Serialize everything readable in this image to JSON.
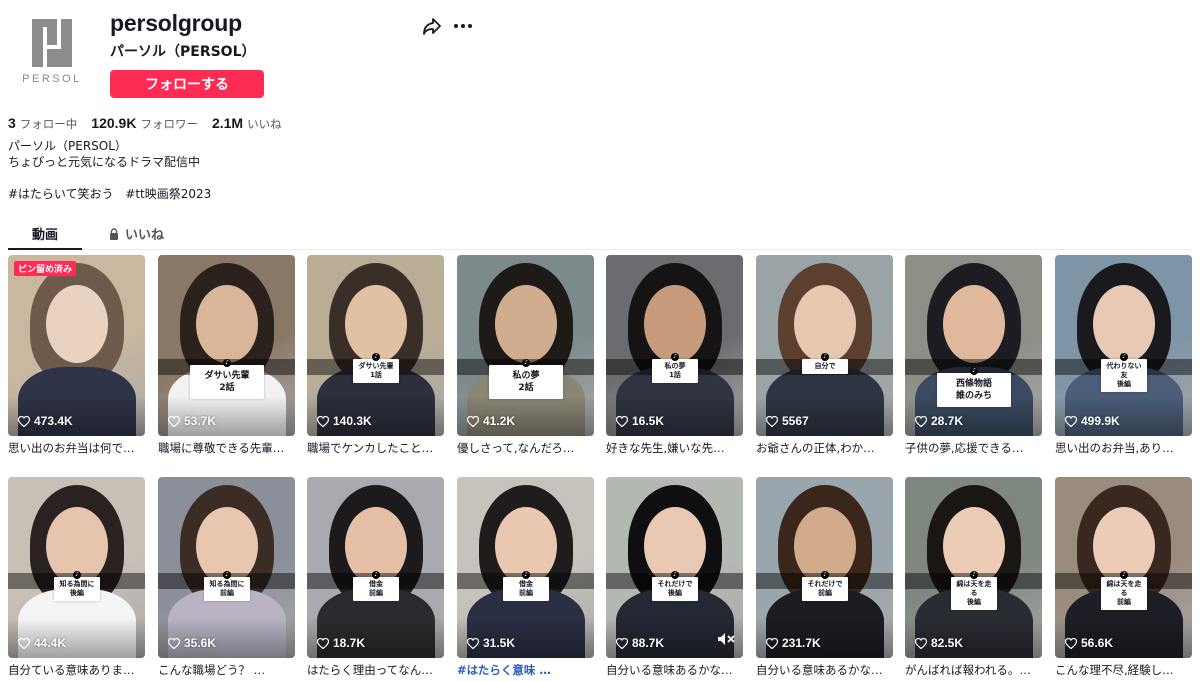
{
  "profile": {
    "brand_text": "PERSOL",
    "username": "persolgroup",
    "nickname": "パーソル（PERSOL）",
    "follow_label": "フォローする",
    "stats": [
      {
        "num": "3",
        "label": "フォロー中"
      },
      {
        "num": "120.9K",
        "label": "フォロワー"
      },
      {
        "num": "2.1M",
        "label": "いいね"
      }
    ],
    "bio_line1": "パーソル（PERSOL）",
    "bio_line2": "ちょぴっと元気になるドラマ配信中",
    "hashtags": [
      "#はたらいて笑おう",
      "#tt映画祭2023"
    ]
  },
  "tabs": {
    "videos": "動画",
    "likes": "いいね"
  },
  "colors": {
    "accent": "#fe2c55",
    "text": "#161823",
    "hashtag": "#2b5db9"
  },
  "videos": [
    {
      "plays": "473.4K",
      "caption": "思い出のお弁当は何で…",
      "badge": "ピン留め済み",
      "sub": ""
    },
    {
      "plays": "53.7K",
      "caption": "職場に尊敬できる先輩…",
      "badge": "",
      "sub": "ダサい先輩\n2話"
    },
    {
      "plays": "140.3K",
      "caption": "職場でケンカしたこと…",
      "badge": "",
      "sub": "ダサい先輩\n1話"
    },
    {
      "plays": "41.2K",
      "caption": "優しさって,なんだろ…",
      "badge": "",
      "sub": "私の夢\n2話"
    },
    {
      "plays": "16.5K",
      "caption": "好きな先生,嫌いな先…",
      "badge": "",
      "sub": "私の夢\n1話"
    },
    {
      "plays": "5567",
      "caption": "お爺さんの正体,わか…",
      "badge": "",
      "sub": "自分で"
    },
    {
      "plays": "28.7K",
      "caption": "子供の夢,応援できる…",
      "badge": "",
      "sub": "西條物語\n誰のみち"
    },
    {
      "plays": "499.9K",
      "caption": "思い出のお弁当,あり…",
      "badge": "",
      "sub": "代わりない友\n後編"
    },
    {
      "plays": "44.4K",
      "caption": "自分ている意味ありま…",
      "badge": "",
      "sub": "知る為間に\n後編"
    },
    {
      "plays": "35.6K",
      "caption": "こんな職場どう？ …",
      "badge": "",
      "sub": "知る為間に\n前編"
    },
    {
      "plays": "18.7K",
      "caption": "はたらく理由ってなん…",
      "badge": "",
      "sub": "借金\n前編"
    },
    {
      "plays": "31.5K",
      "caption": "#はたらく意味 …",
      "badge": "",
      "sub": "借金\n前編"
    },
    {
      "plays": "88.7K",
      "caption": "自分いる意味あるかな…",
      "badge": "",
      "sub": "それだけで\n後編"
    },
    {
      "plays": "231.7K",
      "caption": "自分いる意味あるかな…",
      "badge": "",
      "sub": "それだけで\n前編"
    },
    {
      "plays": "82.5K",
      "caption": "がんばれば報われる。…",
      "badge": "",
      "sub": "綿は天を走る\n後編"
    },
    {
      "plays": "56.6K",
      "caption": "こんな理不尽,経験し…",
      "badge": "",
      "sub": "綿は天を走る\n前編"
    }
  ]
}
